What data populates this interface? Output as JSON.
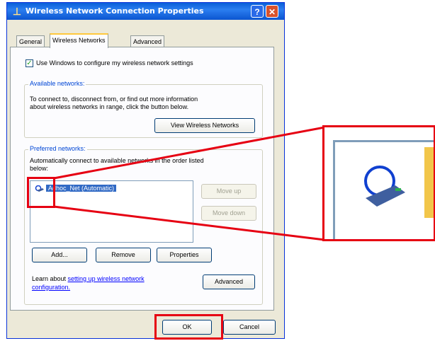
{
  "window": {
    "title": "Wireless Network Connection Properties",
    "help_label": "?",
    "close_label": "✕"
  },
  "tabs": [
    {
      "label": "General"
    },
    {
      "label": "Wireless Networks"
    },
    {
      "label": "Advanced"
    }
  ],
  "use_windows_checkbox": {
    "label": "Use Windows to configure my wireless network settings",
    "checked": true
  },
  "available": {
    "legend": "Available networks:",
    "line1": "To connect to, disconnect from, or find out more information",
    "line2": "about wireless networks in range, click the button below.",
    "view_button": "View Wireless Networks"
  },
  "preferred": {
    "legend": "Preferred networks:",
    "line1": "Automatically connect to available networks in the order listed",
    "line2": "below:",
    "items": [
      {
        "label": "Adhoc_Net (Automatic)"
      }
    ],
    "move_up": "Move up",
    "move_down": "Move down",
    "add": "Add...",
    "remove": "Remove",
    "properties": "Properties",
    "learn_prefix": "Learn about ",
    "learn_link1": "setting up wireless network",
    "learn_link2": "configuration.",
    "advanced_button": "Advanced"
  },
  "footer": {
    "ok": "OK",
    "cancel": "Cancel"
  },
  "colors": {
    "highlight": "#e60012",
    "selection": "#316ac5",
    "titlebar": "#0a5fd8"
  },
  "icons": [
    "network-connection-icon",
    "wireless-network-icon",
    "help-icon",
    "close-icon",
    "checkmark-icon"
  ]
}
